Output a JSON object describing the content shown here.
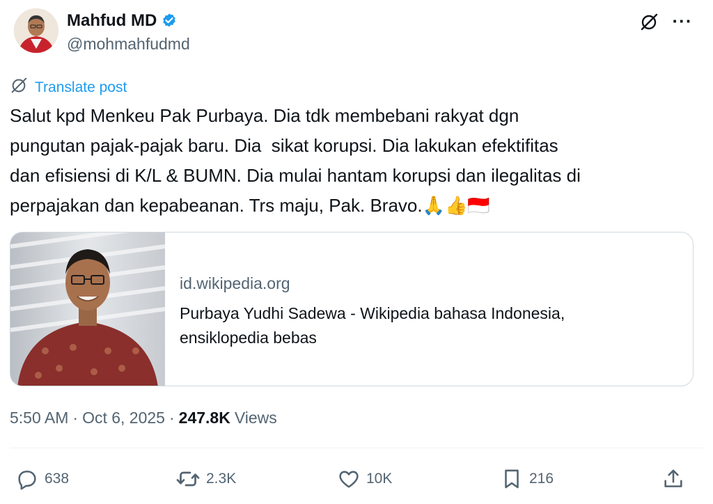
{
  "author": {
    "name": "Mahfud MD",
    "handle": "@mohmahfudmd",
    "verified_icon": "verified-badge-icon",
    "verified_color": "#1d9bf0"
  },
  "header": {
    "grok_icon": "grok-icon",
    "more_icon": "more-options-icon",
    "more_label": "···"
  },
  "translate": {
    "label": "Translate post",
    "icon": "grok-icon",
    "color": "#1d9bf0"
  },
  "post": {
    "text": "Salut kpd Menkeu Pak Purbaya. Dia tdk membebani rakyat dgn\npungutan pajak-pajak baru. Dia  sikat korupsi. Dia lakukan efektifitas\ndan efisiensi di K/L & BUMN. Dia mulai hantam korupsi dan ilegalitas di\nperpajakan dan kepabeanan. Trs maju, Pak. Bravo.🙏👍🇮🇩"
  },
  "link_card": {
    "domain": "id.wikipedia.org",
    "title": "Purbaya Yudhi Sadewa - Wikipedia bahasa Indonesia,\nensiklopedia bebas"
  },
  "meta": {
    "time": "5:50 AM",
    "separator": "·",
    "date": "Oct 6, 2025",
    "views_count": "247.8K",
    "views_label": "Views"
  },
  "actions": {
    "replies": "638",
    "reposts": "2.3K",
    "likes": "10K",
    "bookmarks": "216"
  },
  "colors": {
    "text_primary": "#0f1419",
    "text_secondary": "#536471",
    "accent": "#1d9bf0",
    "border": "#cfd9de"
  }
}
